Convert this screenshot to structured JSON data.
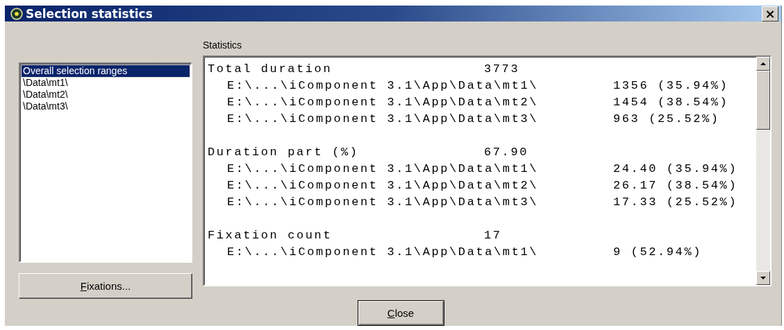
{
  "window": {
    "title": "Selection statistics",
    "close": "×"
  },
  "ranges": [
    {
      "label": "Overall selection ranges",
      "selected": true
    },
    {
      "label": "\\Data\\mt1\\",
      "selected": false
    },
    {
      "label": "\\Data\\mt2\\",
      "selected": false
    },
    {
      "label": "\\Data\\mt3\\",
      "selected": false
    }
  ],
  "fixations_button": "Fixations...",
  "statistics_label": "Statistics",
  "statistics": [
    {
      "label": "Total duration",
      "value": "3773",
      "rows": [
        {
          "path": "E:\\...\\iComponent 3.1\\App\\Data\\mt1\\",
          "value": "1356 (35.94%)"
        },
        {
          "path": "E:\\...\\iComponent 3.1\\App\\Data\\mt2\\",
          "value": "1454 (38.54%)"
        },
        {
          "path": "E:\\...\\iComponent 3.1\\App\\Data\\mt3\\",
          "value": "963 (25.52%)"
        }
      ]
    },
    {
      "label": "Duration part (%)",
      "value": "67.90",
      "rows": [
        {
          "path": "E:\\...\\iComponent 3.1\\App\\Data\\mt1\\",
          "value": "24.40 (35.94%)"
        },
        {
          "path": "E:\\...\\iComponent 3.1\\App\\Data\\mt2\\",
          "value": "26.17 (38.54%)"
        },
        {
          "path": "E:\\...\\iComponent 3.1\\App\\Data\\mt3\\",
          "value": "17.33 (25.52%)"
        }
      ]
    },
    {
      "label": "Fixation count",
      "value": "17",
      "rows": [
        {
          "path": "E:\\...\\iComponent 3.1\\App\\Data\\mt1\\",
          "value": "9 (52.94%)"
        }
      ]
    }
  ],
  "close_button": "Close"
}
